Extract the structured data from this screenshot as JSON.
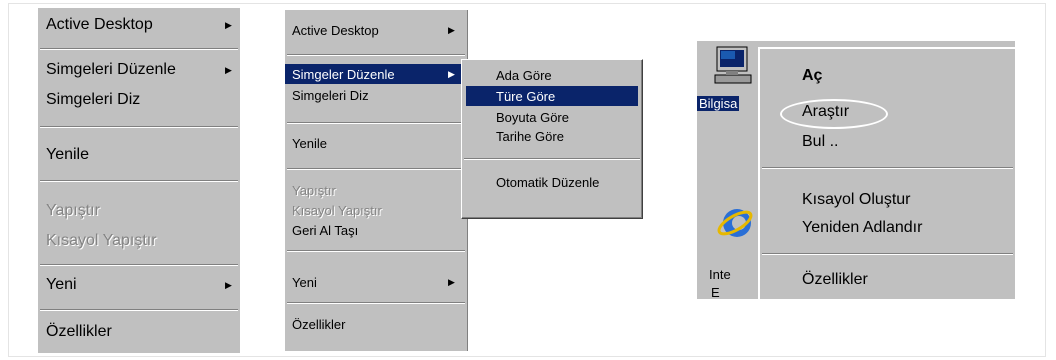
{
  "menu1": {
    "items": [
      {
        "label": "Active Desktop",
        "state": "normal",
        "submenu": true
      },
      {
        "label": "Simgeleri Düzenle",
        "state": "normal",
        "submenu": true
      },
      {
        "label": "Simgeleri Diz",
        "state": "normal",
        "submenu": false
      },
      {
        "label": "Yenile",
        "state": "normal",
        "submenu": false
      },
      {
        "label": "Yapıştır",
        "state": "disabled",
        "submenu": false
      },
      {
        "label": "Kısayol Yapıştır",
        "state": "disabled",
        "submenu": false
      },
      {
        "label": "Yeni",
        "state": "normal",
        "submenu": true
      },
      {
        "label": "Özellikler",
        "state": "normal",
        "submenu": false
      }
    ]
  },
  "menu2": {
    "items": [
      {
        "label": "Active Desktop",
        "state": "normal",
        "submenu": true
      },
      {
        "label": "Simgeler Düzenle",
        "state": "selected",
        "submenu": true
      },
      {
        "label": "Simgeleri Diz",
        "state": "normal",
        "submenu": false
      },
      {
        "label": "Yenile",
        "state": "normal",
        "submenu": false
      },
      {
        "label": "Yapıştır",
        "state": "disabled",
        "submenu": false
      },
      {
        "label": "Kısayol Yapıştır",
        "state": "disabled",
        "submenu": false
      },
      {
        "label": "Geri Al Taşı",
        "state": "normal",
        "submenu": false
      },
      {
        "label": "Yeni",
        "state": "normal",
        "submenu": true
      },
      {
        "label": "Özellikler",
        "state": "normal",
        "submenu": false
      }
    ]
  },
  "submenu": {
    "items": [
      {
        "label": "Ada Göre",
        "state": "normal"
      },
      {
        "label": "Türe Göre",
        "state": "selected"
      },
      {
        "label": "Boyuta Göre",
        "state": "normal"
      },
      {
        "label": "Tarihe Göre",
        "state": "normal"
      },
      {
        "label": "Otomatik Düzenle",
        "state": "normal"
      }
    ]
  },
  "context": {
    "desktop_labels": [
      "Bilgisa",
      "Inte",
      "E"
    ],
    "items": [
      {
        "label": "Aç",
        "state": "bold"
      },
      {
        "label": "Araştır",
        "state": "normal"
      },
      {
        "label": "Bul ..",
        "state": "normal"
      },
      {
        "label": "Kısayol Oluştur",
        "state": "normal"
      },
      {
        "label": "Yeniden Adlandır",
        "state": "normal"
      },
      {
        "label": "Özellikler",
        "state": "normal"
      }
    ]
  },
  "colors": {
    "menu_bg": "#c0c0c0",
    "highlight": "#0a246a",
    "disabled": "#848484"
  }
}
